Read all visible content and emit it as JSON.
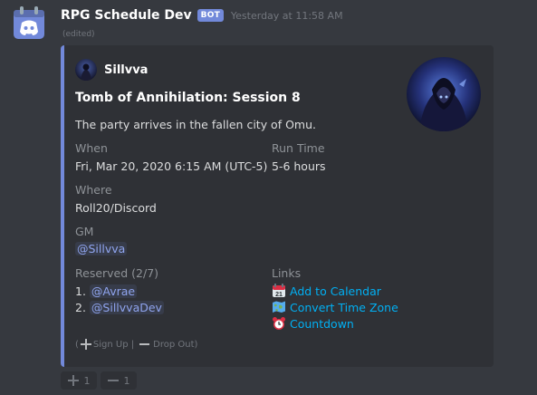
{
  "message": {
    "author": "RPG Schedule Dev",
    "bot_badge": "BOT",
    "timestamp": "Yesterday at 11:58 AM",
    "edited": "(edited)"
  },
  "embed": {
    "accent_color": "#7289da",
    "author_name": "Sillvva",
    "title": "Tomb of Annihilation: Session 8",
    "description": "The party arrives in the fallen city of Omu.",
    "fields": {
      "when": {
        "name": "When",
        "value": "Fri, Mar 20, 2020 6:15 AM (UTC-5)"
      },
      "run_time": {
        "name": "Run Time",
        "value": "5-6 hours"
      },
      "where": {
        "name": "Where",
        "value": "Roll20/Discord"
      },
      "gm": {
        "name": "GM",
        "value": "@Sillvva"
      },
      "reserved": {
        "name": "Reserved (2/7)",
        "players": [
          {
            "num": "1.",
            "mention": "@Avrae"
          },
          {
            "num": "2.",
            "mention": "@SillvvaDev"
          }
        ]
      },
      "links": {
        "name": "Links",
        "items": [
          {
            "icon": "calendar-icon",
            "label": "Add to Calendar"
          },
          {
            "icon": "world-map-icon",
            "label": "Convert Time Zone"
          },
          {
            "icon": "alarm-clock-icon",
            "label": "Countdown"
          }
        ]
      }
    },
    "footer": {
      "open": "(",
      "sign_up": "Sign Up |",
      "drop_out": "Drop Out)"
    }
  },
  "reactions": [
    {
      "icon": "plus-icon",
      "count": "1"
    },
    {
      "icon": "minus-icon",
      "count": "1"
    }
  ]
}
